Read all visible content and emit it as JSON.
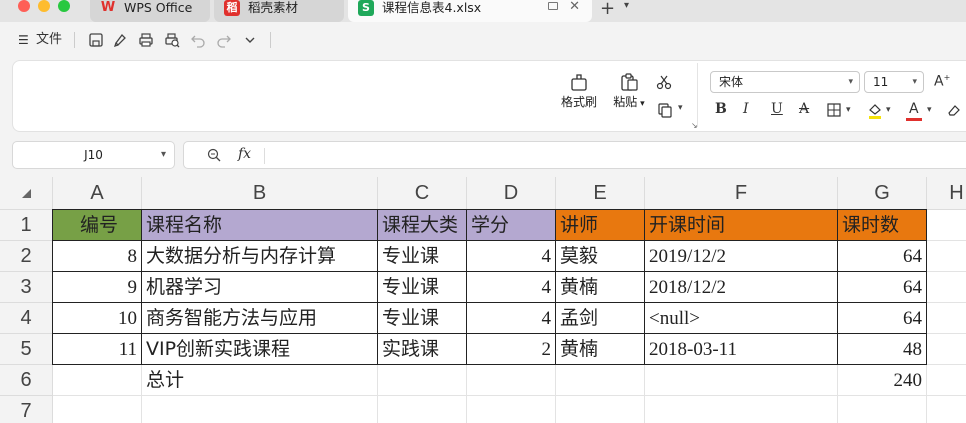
{
  "tabs": [
    {
      "label": "WPS Office"
    },
    {
      "label": "稻壳素材"
    },
    {
      "label": "课程信息表4.xlsx"
    }
  ],
  "menu": {
    "file_label": "文件"
  },
  "ribbon": {
    "format_painter": "格式刷",
    "paste": "粘贴",
    "font_name": "宋体",
    "font_size": "11"
  },
  "formula_bar": {
    "name_box": "J10",
    "fx_label": "fx",
    "value": ""
  },
  "sheet": {
    "columns": [
      "A",
      "B",
      "C",
      "D",
      "E",
      "F",
      "G",
      "H"
    ],
    "row_numbers": [
      "1",
      "2",
      "3",
      "4",
      "5",
      "6",
      "7"
    ],
    "header": [
      "编号",
      "课程名称",
      "课程大类",
      "学分",
      "讲师",
      "开课时间",
      "课时数"
    ],
    "rows": [
      [
        "8",
        "大数据分析与内存计算",
        "专业课",
        "4",
        "莫毅",
        "2019/12/2",
        "64"
      ],
      [
        "9",
        "机器学习",
        "专业课",
        "4",
        "黄楠",
        "2018/12/2",
        "64"
      ],
      [
        "10",
        "商务智能方法与应用",
        "专业课",
        "4",
        "孟剑",
        "<null>",
        "64"
      ],
      [
        "11",
        "VIP创新实践课程",
        "实践课",
        "2",
        "黄楠",
        "2018-03-11",
        "48"
      ]
    ],
    "total_label": "总计",
    "total_value": "240",
    "header_colors": {
      "A": "#77a046",
      "B": "#b4a8d0",
      "C": "#b4a8d0",
      "D": "#b4a8d0",
      "E": "#e8780f",
      "F": "#e8780f",
      "G": "#e8780f"
    }
  }
}
